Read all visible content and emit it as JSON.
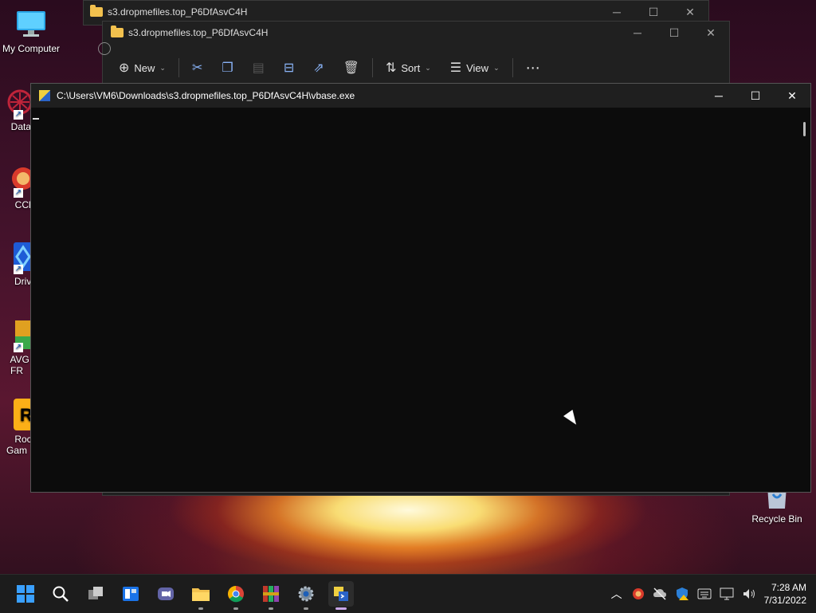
{
  "desktop": {
    "icons": [
      {
        "label": "My Computer"
      },
      {
        "label": "DataW"
      },
      {
        "label": "CCle"
      },
      {
        "label": "Drive"
      },
      {
        "label": "AVG Ar FR"
      },
      {
        "label": "Rock Gam"
      },
      {
        "label": "Recycle Bin"
      }
    ]
  },
  "explorer_back": {
    "title": "s3.dropmefiles.top_P6DfAsvC4H"
  },
  "explorer_front": {
    "title": "s3.dropmefiles.top_P6DfAsvC4H",
    "toolbar": {
      "new_label": "New",
      "sort_label": "Sort",
      "view_label": "View",
      "more_label": "⋯"
    }
  },
  "console": {
    "title": "C:\\Users\\VM6\\Downloads\\s3.dropmefiles.top_P6DfAsvC4H\\vbase.exe"
  },
  "taskbar": {
    "clock_time": "7:28 AM",
    "clock_date": "7/31/2022"
  },
  "colors": {
    "accent": "#0078d4",
    "console_bg": "#0c0c0c",
    "folder": "#f2c14e"
  }
}
